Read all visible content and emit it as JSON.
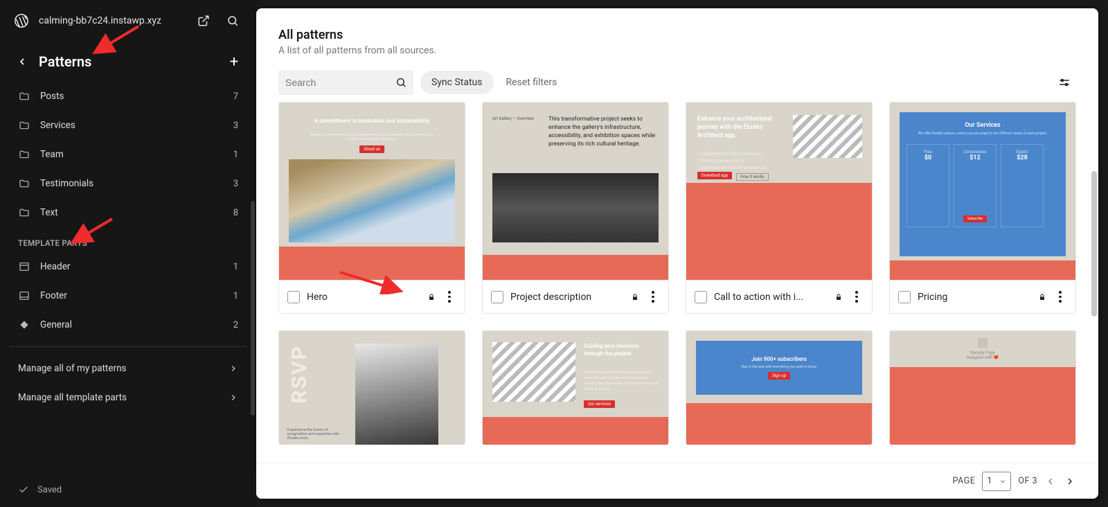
{
  "topbar": {
    "site_name": "calming-bb7c24.instawp.xyz"
  },
  "panel": {
    "title": "Patterns"
  },
  "categories": [
    {
      "label": "Posts",
      "count": "7",
      "icon": "folder"
    },
    {
      "label": "Services",
      "count": "3",
      "icon": "folder"
    },
    {
      "label": "Team",
      "count": "1",
      "icon": "folder"
    },
    {
      "label": "Testimonials",
      "count": "3",
      "icon": "folder"
    },
    {
      "label": "Text",
      "count": "8",
      "icon": "folder"
    }
  ],
  "template_parts_label": "TEMPLATE PARTS",
  "template_parts": [
    {
      "label": "Header",
      "count": "1",
      "icon": "header"
    },
    {
      "label": "Footer",
      "count": "1",
      "icon": "footer"
    },
    {
      "label": "General",
      "count": "2",
      "icon": "diamond"
    }
  ],
  "manage_links": {
    "my_patterns": "Manage all of my patterns",
    "template_parts": "Manage all template parts"
  },
  "saved_label": "Saved",
  "main": {
    "title": "All patterns",
    "subtitle": "A list of all patterns from all sources."
  },
  "toolbar": {
    "search_placeholder": "Search",
    "sync_status": "Sync Status",
    "reset": "Reset filters"
  },
  "cards": [
    {
      "title": "Hero"
    },
    {
      "title": "Project description"
    },
    {
      "title": "Call to action with i..."
    },
    {
      "title": "Pricing"
    }
  ],
  "preview_texts": {
    "hero_heading": "A commitment to innovation and sustainability",
    "project_desc": "This transformative project seeks to enhance the gallery's infrastructure, accessibility, and exhibition spaces while preserving its rich cultural heritage.",
    "cta_heading": "Enhance your architectural journey with the Études Architect app.",
    "pricing_title": "Our Services",
    "rsvp": "RSVP",
    "subscribe": "Join 900+ subscribers",
    "guiding": "Guiding your business through the project"
  },
  "pricing_plans": {
    "free": {
      "name": "Free",
      "price": "$0"
    },
    "connoisseur": {
      "name": "Connoisseur",
      "price": "$12"
    },
    "expert": {
      "name": "Expert",
      "price": "$28"
    }
  },
  "pagination": {
    "page_label": "PAGE",
    "current": "1",
    "of_label": "OF 3"
  }
}
